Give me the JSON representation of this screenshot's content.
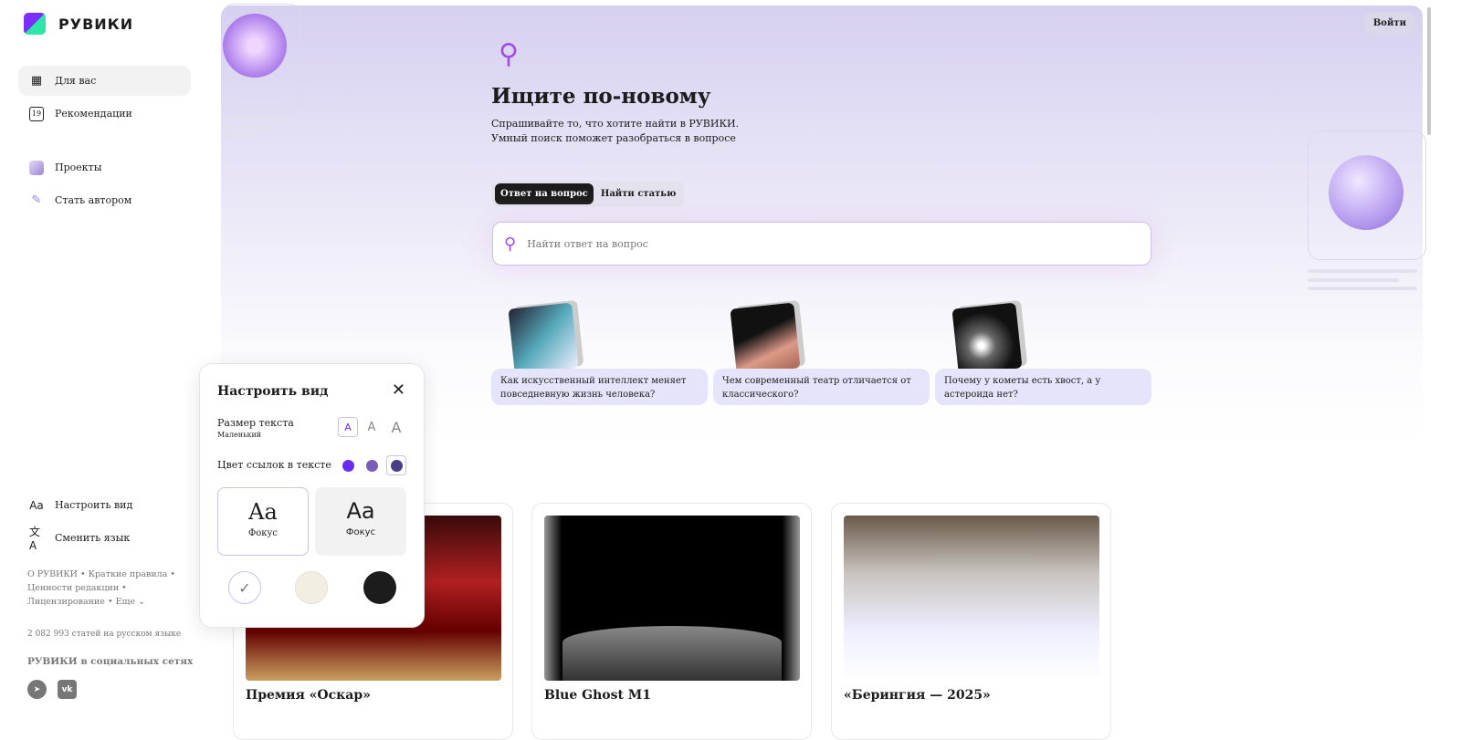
{
  "brand": "РУВИКИ",
  "nav": [
    {
      "label": "Для вас",
      "icon": "grid-icon"
    },
    {
      "label": "Рекомендации",
      "icon": "calendar-icon"
    },
    {
      "label": "Проекты",
      "icon": "projects-icon"
    },
    {
      "label": "Стать автором",
      "icon": "pen-icon"
    }
  ],
  "bottom_nav": [
    {
      "label": "Настроить вид",
      "icon": "text-size-icon"
    },
    {
      "label": "Сменить язык",
      "icon": "translate-icon"
    }
  ],
  "footer_links": [
    "О РУВИКИ",
    "Краткие правила",
    "Ценности редакции",
    "Лицензирование",
    "Еще"
  ],
  "stats": "2 082 993 статей на русском языке",
  "social_title": "РУВИКИ в социальных сетях",
  "social": [
    "telegram",
    "vk"
  ],
  "login": "Войти",
  "hero": {
    "title": "Ищите по-новому",
    "subtitle": "Спрашивайте то, что хотите найти в РУВИКИ. Умный поиск поможет разобраться в вопросе"
  },
  "tabs": [
    "Ответ на вопрос",
    "Найти статью"
  ],
  "search": {
    "placeholder": "Найти ответ на вопрос"
  },
  "questions": [
    "Как искусственный интеллект меняет повседневную жизнь человека?",
    "Чем современный театр отличается от классического?",
    "Почему у кометы есть хвост, а у астероида нет?"
  ],
  "cards": [
    "Премия «Оскар»",
    "Blue Ghost M1",
    "«Берингия — 2025»"
  ],
  "popup": {
    "title": "Настроить вид",
    "text_size_label": "Размер текста",
    "text_size_value": "Маленький",
    "size_glyph": "A",
    "link_color_label": "Цвет ссылок в тексте",
    "link_colors": [
      "#6a2cf5",
      "#7a5cb8",
      "#4a3d86"
    ],
    "font_sample": "Aa",
    "fonts": [
      "Фокус",
      "Фокус"
    ],
    "themes": [
      "#ffffff",
      "#f3eee2",
      "#1c1c1c"
    ]
  }
}
